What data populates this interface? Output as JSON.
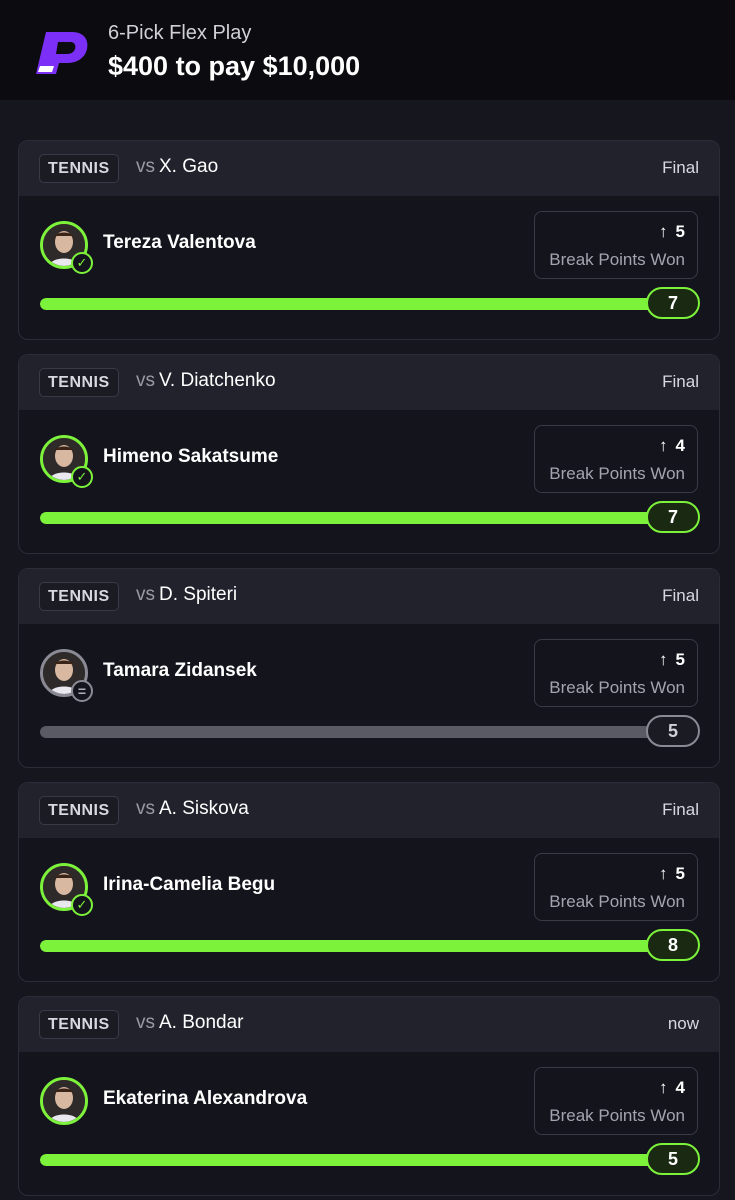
{
  "header": {
    "logo_icon": "prizepicks-p-logo-icon",
    "subtitle": "6-Pick Flex Play",
    "title": "$400 to pay $10,000"
  },
  "colors": {
    "accent_green": "#7cf23b",
    "push_gray": "#8a8a94",
    "logo_purple": "#7b2ff7"
  },
  "picks": [
    {
      "sport": "TENNIS",
      "vs_label": "vs",
      "opponent": "X. Gao",
      "status": "Final",
      "player": "Tereza Valentova",
      "result_icon": "check-icon",
      "result_state": "hit",
      "direction_icon": "arrow-up-icon",
      "line": "5",
      "stat": "Break Points Won",
      "actual": "7",
      "progress": 1.0
    },
    {
      "sport": "TENNIS",
      "vs_label": "vs",
      "opponent": "V. Diatchenko",
      "status": "Final",
      "player": "Himeno Sakatsume",
      "result_icon": "check-icon",
      "result_state": "hit",
      "direction_icon": "arrow-up-icon",
      "line": "4",
      "stat": "Break Points Won",
      "actual": "7",
      "progress": 1.0
    },
    {
      "sport": "TENNIS",
      "vs_label": "vs",
      "opponent": "D. Spiteri",
      "status": "Final",
      "player": "Tamara Zidansek",
      "result_icon": "equals-icon",
      "result_state": "push",
      "direction_icon": "arrow-up-icon",
      "line": "5",
      "stat": "Break Points Won",
      "actual": "5",
      "progress": 1.0
    },
    {
      "sport": "TENNIS",
      "vs_label": "vs",
      "opponent": "A. Siskova",
      "status": "Final",
      "player": "Irina-Camelia Begu",
      "result_icon": "check-icon",
      "result_state": "hit",
      "direction_icon": "arrow-up-icon",
      "line": "5",
      "stat": "Break Points Won",
      "actual": "8",
      "progress": 1.0
    },
    {
      "sport": "TENNIS",
      "vs_label": "vs",
      "opponent": "A. Bondar",
      "status": "now",
      "player": "Ekaterina Alexandrova",
      "result_icon": "",
      "result_state": "live",
      "direction_icon": "arrow-up-icon",
      "line": "4",
      "stat": "Break Points Won",
      "actual": "5",
      "progress": 1.0
    }
  ]
}
